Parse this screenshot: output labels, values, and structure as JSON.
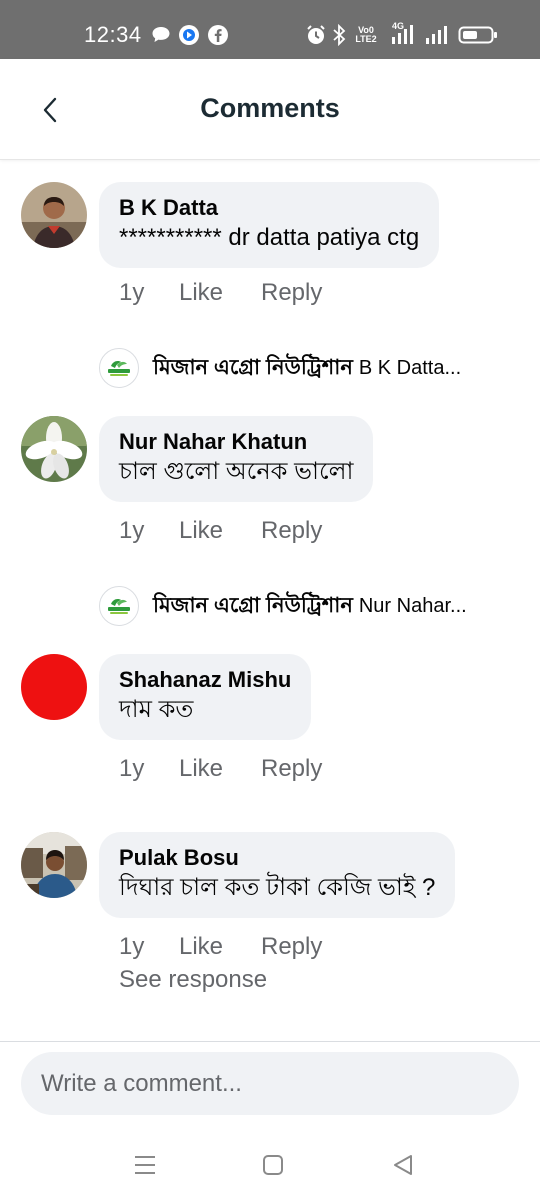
{
  "status_bar": {
    "time": "12:34",
    "network_label_top": "Vo0",
    "network_label_bottom": "LTE2",
    "signal_label": "4G"
  },
  "header": {
    "title": "Comments"
  },
  "comments": [
    {
      "author": "B K Datta",
      "text": "*********** dr datta patiya ctg",
      "age": "1y",
      "like_label": "Like",
      "reply_label": "Reply",
      "reply_preview": {
        "name": "মিজান এগ্রো নিউট্রিশান",
        "text": "B K Datta..."
      }
    },
    {
      "author": "Nur Nahar Khatun",
      "text": "চাল গুলো অনেক ভালো",
      "age": "1y",
      "like_label": "Like",
      "reply_label": "Reply",
      "reply_preview": {
        "name": "মিজান এগ্রো নিউট্রিশান",
        "text": "Nur Nahar..."
      }
    },
    {
      "author": "Shahanaz Mishu",
      "text": "দাম কত",
      "age": "1y",
      "like_label": "Like",
      "reply_label": "Reply"
    },
    {
      "author": "Pulak Bosu",
      "text": "দিঘার চাল কত টাকা কেজি  ভাই ?",
      "age": "1y",
      "like_label": "Like",
      "reply_label": "Reply",
      "see_response": "See response"
    }
  ],
  "composer": {
    "placeholder": "Write a comment..."
  },
  "colors": {
    "status_bar": "#6f6f6f",
    "bubble": "#f0f2f5",
    "secondary_text": "#65676b",
    "avatar_red": "#ee1111"
  },
  "icons": [
    "back-arrow-icon",
    "menu-icon",
    "home-icon",
    "back-triangle-icon"
  ]
}
